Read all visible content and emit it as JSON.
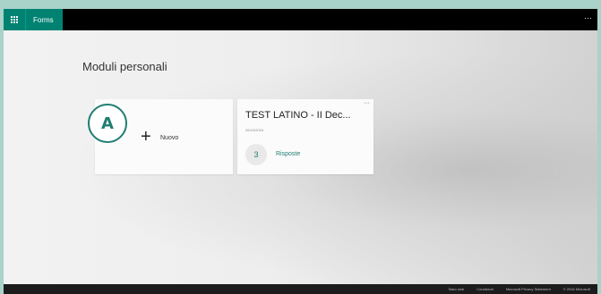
{
  "header": {
    "app_name": "Forms",
    "more_label": "···"
  },
  "main": {
    "section_title": "Moduli personali",
    "new_card": {
      "plus": "+",
      "label": "Nuovo",
      "annotation": "A"
    },
    "form_card": {
      "title": "TEST LATINO - II Dec...",
      "date": "26/10/2016",
      "more_label": "···",
      "response_count": "3",
      "responses_label": "Risposte"
    }
  },
  "footer": {
    "links": [
      "Tasto web",
      "Condizioni",
      "Microsoft Privacy Statement"
    ],
    "copyright": "© 2016 Microsoft"
  },
  "colors": {
    "accent": "#008272",
    "accent_text": "#1f7d72",
    "topbar": "#000000",
    "footer": "#1c1c1c",
    "page_bg": "#a9d2c8"
  }
}
